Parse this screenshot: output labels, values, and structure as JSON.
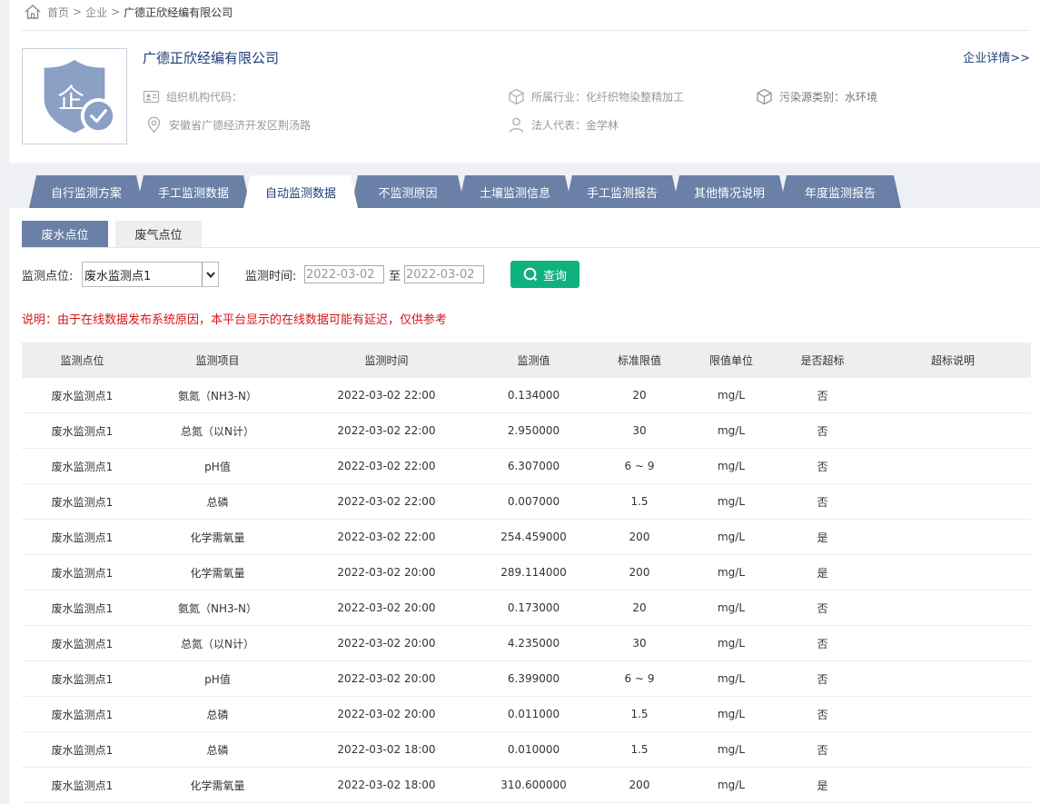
{
  "breadcrumb": {
    "home": "首页",
    "sep1": ">",
    "enterprise": "企业",
    "sep2": ">",
    "current": "广德正欣经编有限公司"
  },
  "company": {
    "name": "广德正欣经编有限公司",
    "detail_link": "企业详情>>",
    "org_code_label": "组织机构代码：",
    "address": "安徽省广德经济开发区荆汤路",
    "industry": "所属行业：化纤织物染整精加工",
    "legal_rep": "法人代表：金学林",
    "pollution_type": "污染源类别：水环境",
    "logo_char": "企"
  },
  "tabs": [
    "自行监测方案",
    "手工监测数据",
    "自动监测数据",
    "不监测原因",
    "土壤监测信息",
    "手工监测报告",
    "其他情况说明",
    "年度监测报告"
  ],
  "active_tab": 2,
  "subtabs": [
    "废水点位",
    "废气点位"
  ],
  "filter": {
    "point_label": "监测点位:",
    "point_value": "废水监测点1",
    "time_label": "监测时间:",
    "date_from": "2022-03-02",
    "to_label": "至",
    "date_to": "2022-03-02",
    "query_label": "查询"
  },
  "notice": "说明：由于在线数据发布系统原因，本平台显示的在线数据可能有延迟，仅供参考",
  "table": {
    "headers": [
      "监测点位",
      "监测项目",
      "监测时间",
      "监测值",
      "标准限值",
      "限值单位",
      "是否超标",
      "超标说明"
    ],
    "rows": [
      [
        "废水监测点1",
        "氨氮（NH3-N）",
        "2022-03-02 22:00",
        "0.134000",
        "20",
        "mg/L",
        "否",
        ""
      ],
      [
        "废水监测点1",
        "总氮（以N计）",
        "2022-03-02 22:00",
        "2.950000",
        "30",
        "mg/L",
        "否",
        ""
      ],
      [
        "废水监测点1",
        "pH值",
        "2022-03-02 22:00",
        "6.307000",
        "6 ~ 9",
        "mg/L",
        "否",
        ""
      ],
      [
        "废水监测点1",
        "总磷",
        "2022-03-02 22:00",
        "0.007000",
        "1.5",
        "mg/L",
        "否",
        ""
      ],
      [
        "废水监测点1",
        "化学需氧量",
        "2022-03-02 22:00",
        "254.459000",
        "200",
        "mg/L",
        "是",
        ""
      ],
      [
        "废水监测点1",
        "化学需氧量",
        "2022-03-02 20:00",
        "289.114000",
        "200",
        "mg/L",
        "是",
        ""
      ],
      [
        "废水监测点1",
        "氨氮（NH3-N）",
        "2022-03-02 20:00",
        "0.173000",
        "20",
        "mg/L",
        "否",
        ""
      ],
      [
        "废水监测点1",
        "总氮（以N计）",
        "2022-03-02 20:00",
        "4.235000",
        "30",
        "mg/L",
        "否",
        ""
      ],
      [
        "废水监测点1",
        "pH值",
        "2022-03-02 20:00",
        "6.399000",
        "6 ~ 9",
        "mg/L",
        "否",
        ""
      ],
      [
        "废水监测点1",
        "总磷",
        "2022-03-02 20:00",
        "0.011000",
        "1.5",
        "mg/L",
        "否",
        ""
      ],
      [
        "废水监测点1",
        "总磷",
        "2022-03-02 18:00",
        "0.010000",
        "1.5",
        "mg/L",
        "否",
        ""
      ],
      [
        "废水监测点1",
        "化学需氧量",
        "2022-03-02 18:00",
        "310.600000",
        "200",
        "mg/L",
        "是",
        ""
      ]
    ]
  },
  "colors": {
    "tab_bg": "#6a80a6",
    "accent_text": "#1d3f78",
    "query_btn": "#0fb27f",
    "notice": "#d8141b"
  }
}
